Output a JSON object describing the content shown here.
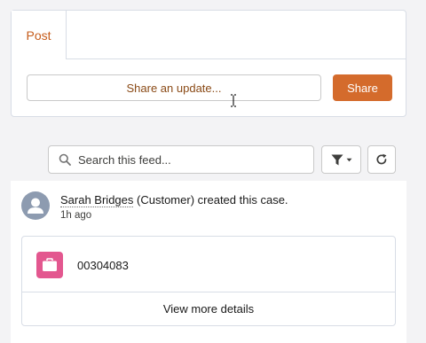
{
  "publisher": {
    "tab_label": "Post",
    "input_placeholder": "Share an update...",
    "share_label": "Share"
  },
  "feed_toolbar": {
    "search_placeholder": "Search this feed..."
  },
  "feed_item": {
    "actor_name": "Sarah Bridges",
    "actor_role": "(Customer)",
    "action_text": "created this case.",
    "timestamp": "1h ago",
    "record_number": "00304083",
    "view_more_label": "View more details"
  },
  "colors": {
    "accent": "#d46b2c",
    "tab_text": "#c65c1b",
    "case_icon": "#e3578f",
    "avatar": "#8d9bb0"
  },
  "icons": {
    "search": "search-icon",
    "filter": "filter-icon",
    "refresh": "refresh-icon",
    "avatar": "user-icon",
    "case": "case-icon"
  }
}
